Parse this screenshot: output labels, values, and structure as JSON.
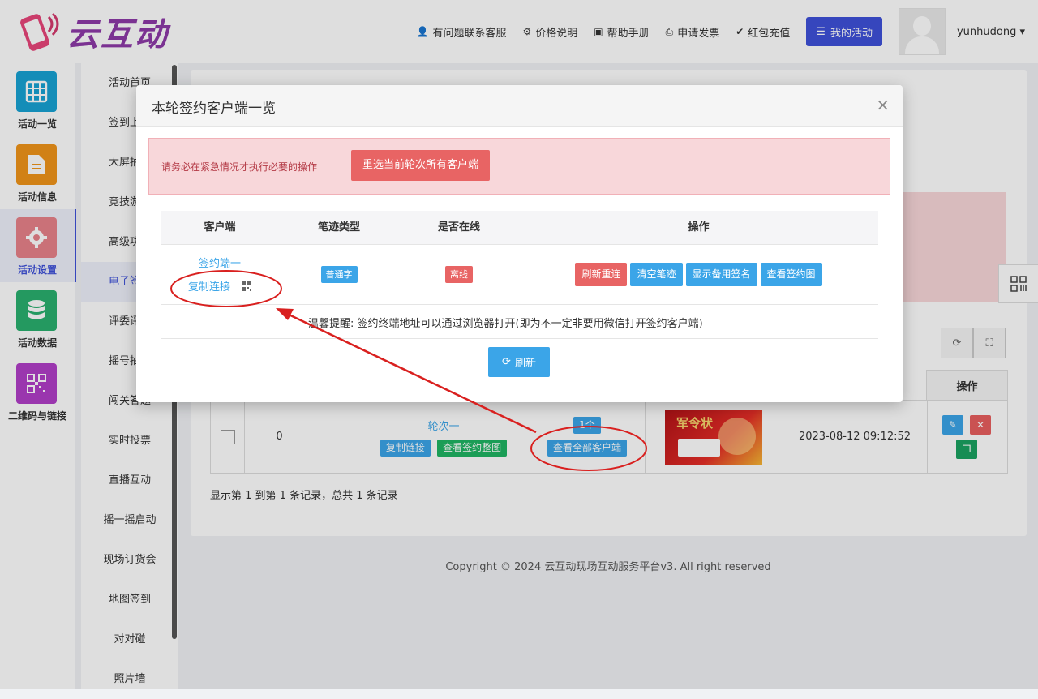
{
  "brand": {
    "name": "云互动"
  },
  "top_nav": {
    "links": [
      {
        "icon": "user-plus-icon",
        "label": "有问题联系客服"
      },
      {
        "icon": "gear-icon",
        "label": "价格说明"
      },
      {
        "icon": "book-icon",
        "label": "帮助手册"
      },
      {
        "icon": "print-icon",
        "label": "申请发票"
      },
      {
        "icon": "check-badge-icon",
        "label": "红包充值"
      }
    ],
    "my_activity": "我的活动",
    "username": "yunhudong"
  },
  "sidebar": {
    "items": [
      {
        "label": "活动一览",
        "icon": "grid-icon",
        "color": "#17a2d4"
      },
      {
        "label": "活动信息",
        "icon": "document-icon",
        "color": "#f0951a"
      },
      {
        "label": "活动设置",
        "icon": "settings-icon",
        "color": "#e8828a"
      },
      {
        "label": "活动数据",
        "icon": "database-icon",
        "color": "#2ab06f"
      },
      {
        "label": "二维码与链接",
        "icon": "qr-icon",
        "color": "#b13fc8"
      }
    ],
    "active_index": 2
  },
  "sub_sidebar": {
    "items": [
      "活动首页",
      "签到上墙",
      "大屏抽奖",
      "竞技游戏",
      "高级功能",
      "电子签名",
      "评委评分",
      "摇号抽奖",
      "闯关答题",
      "实时投票",
      "直播互动",
      "摇一摇启动",
      "现场订货会",
      "地图签到",
      "对对碰",
      "照片墙"
    ],
    "active_index": 5
  },
  "background_table": {
    "op_header": "操作",
    "row": {
      "index": "0",
      "round": "轮次一",
      "copy_link": "复制链接",
      "view_sign": "查看签约整图",
      "count": "1个",
      "view_all_clients": "查看全部客户端",
      "thumb_title": "军令状",
      "time": "2023-08-12 09:12:52"
    },
    "summary": "显示第 1 到第 1 条记录，总共 1 条记录"
  },
  "copyright": "Copyright © 2024 云互动现场互动服务平台v3. All right reserved",
  "modal": {
    "title": "本轮签约客户端一览",
    "warning_text": "请务必在紧急情况才执行必要的操作",
    "warning_button": "重选当前轮次所有客户端",
    "headers": {
      "client": "客户端",
      "stroke": "笔迹类型",
      "online": "是否在线",
      "action": "操作"
    },
    "row": {
      "client_name": "签约端一",
      "copy_link": "复制连接",
      "stroke_type": "普通字",
      "online_status": "离线",
      "actions": [
        "刷新重连",
        "清空笔迹",
        "显示备用签名",
        "查看签约图"
      ]
    },
    "tip": "温馨提醒: 签约终端地址可以通过浏览器打开(即为不一定非要用微信打开签约客户端)",
    "refresh": "刷新"
  },
  "colors": {
    "accent": "#3f51d9",
    "info": "#3ba5e8",
    "danger": "#e86464",
    "success": "#1fb563",
    "annotation": "#d9201f"
  }
}
